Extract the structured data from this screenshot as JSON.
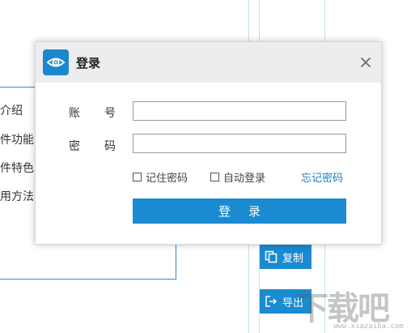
{
  "background": {
    "menu_items": [
      "介绍",
      "件功能",
      "件特色",
      "用方法"
    ],
    "buttons": [
      {
        "label": "复制",
        "icon": "copy-icon"
      },
      {
        "label": "导出",
        "icon": "export-icon"
      }
    ],
    "watermark": "下载吧",
    "watermark_url": "www.xiazaiba.com"
  },
  "dialog": {
    "title": "登录",
    "logo_icon": "eye-icon",
    "close_icon": "close-icon",
    "account_label": [
      "账",
      "号"
    ],
    "password_label": [
      "密",
      "码"
    ],
    "account_value": "",
    "password_value": "",
    "remember_password": "记住密码",
    "auto_login": "自动登录",
    "forgot_password": "忘记密码",
    "login_button": "登录"
  },
  "colors": {
    "accent": "#1a8ad1",
    "link": "#1a7fc4",
    "header_bg": "#ededf0"
  }
}
